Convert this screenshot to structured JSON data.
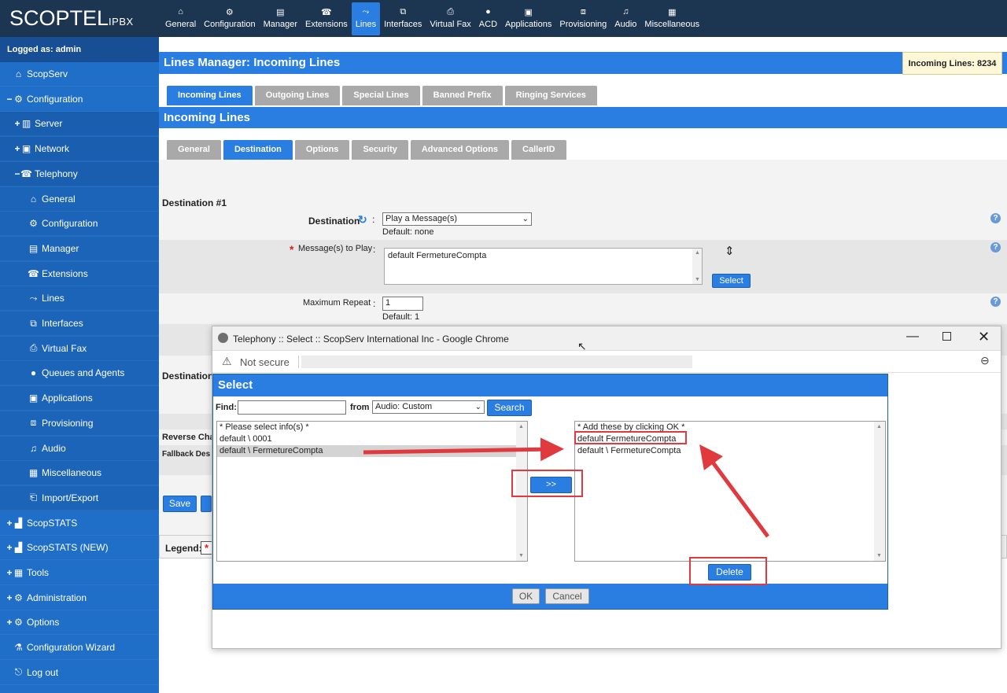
{
  "app": {
    "logo_main": "SCOPTEL",
    "logo_sub": "IPBX"
  },
  "topnav": [
    {
      "label": "General",
      "icon": "home-icon"
    },
    {
      "label": "Configuration",
      "icon": "gear-icon"
    },
    {
      "label": "Manager",
      "icon": "manager-icon"
    },
    {
      "label": "Extensions",
      "icon": "phone-icon"
    },
    {
      "label": "Lines",
      "icon": "lines-icon",
      "active": true
    },
    {
      "label": "Interfaces",
      "icon": "interfaces-icon"
    },
    {
      "label": "Virtual Fax",
      "icon": "fax-icon"
    },
    {
      "label": "ACD",
      "icon": "person-icon"
    },
    {
      "label": "Applications",
      "icon": "applications-icon"
    },
    {
      "label": "Provisioning",
      "icon": "provisioning-icon"
    },
    {
      "label": "Audio",
      "icon": "music-icon"
    },
    {
      "label": "Miscellaneous",
      "icon": "grid-icon"
    }
  ],
  "sidebar": {
    "logged_as": "Logged as: admin",
    "items": [
      {
        "label": "ScopServ",
        "exp": "",
        "level": 0
      },
      {
        "label": "Configuration",
        "exp": "−",
        "level": 0
      },
      {
        "label": "Server",
        "exp": "+",
        "level": 1
      },
      {
        "label": "Network",
        "exp": "+",
        "level": 1
      },
      {
        "label": "Telephony",
        "exp": "−",
        "level": 1
      },
      {
        "label": "General",
        "exp": "",
        "level": 2
      },
      {
        "label": "Configuration",
        "exp": "",
        "level": 2
      },
      {
        "label": "Manager",
        "exp": "",
        "level": 2
      },
      {
        "label": "Extensions",
        "exp": "",
        "level": 2
      },
      {
        "label": "Lines",
        "exp": "",
        "level": 2
      },
      {
        "label": "Interfaces",
        "exp": "",
        "level": 2
      },
      {
        "label": "Virtual Fax",
        "exp": "",
        "level": 2
      },
      {
        "label": "Queues and Agents",
        "exp": "",
        "level": 2
      },
      {
        "label": "Applications",
        "exp": "",
        "level": 2
      },
      {
        "label": "Provisioning",
        "exp": "",
        "level": 2
      },
      {
        "label": "Audio",
        "exp": "",
        "level": 2
      },
      {
        "label": "Miscellaneous",
        "exp": "",
        "level": 2
      },
      {
        "label": "Import/Export",
        "exp": "",
        "level": 2
      },
      {
        "label": "ScopSTATS",
        "exp": "+",
        "level": 0
      },
      {
        "label": "ScopSTATS (NEW)",
        "exp": "+",
        "level": 0
      },
      {
        "label": "Tools",
        "exp": "+",
        "level": 0
      },
      {
        "label": "Administration",
        "exp": "+",
        "level": 0
      },
      {
        "label": "Options",
        "exp": "+",
        "level": 0
      },
      {
        "label": "Configuration Wizard",
        "exp": "",
        "level": 0
      },
      {
        "label": "Log out",
        "exp": "",
        "level": 0
      }
    ]
  },
  "main": {
    "title": "Lines Manager:  Incoming Lines",
    "count_badge": "Incoming Lines: 8234",
    "tabs": [
      "Incoming Lines",
      "Outgoing Lines",
      "Special Lines",
      "Banned Prefix",
      "Ringing Services"
    ],
    "section_title": "Incoming Lines",
    "subtabs": [
      "General",
      "Destination",
      "Options",
      "Security",
      "Advanced Options",
      "CallerID"
    ],
    "destination_heading": "Destination #1",
    "destination_label": "Destination",
    "destination_value": "Play a Message(s)",
    "destination_default": "Default: none",
    "messages_label": "Message(s) to Play",
    "messages_value": "default FermetureCompta",
    "select_button": "Select",
    "max_repeat_label": "Maximum Repeat",
    "max_repeat_value": "1",
    "max_repeat_default": "Default: 1",
    "destination2_partial": "Destination",
    "reverse_partial": "Reverse Cha",
    "fallback_partial": "Fallback Des",
    "save_button": "Save",
    "legend_label": "Legend:"
  },
  "popup": {
    "window_title": "Telephony :: Select :: ScopServ International Inc - Google Chrome",
    "not_secure": "Not secure",
    "heading": "Select",
    "find_label": "Find:",
    "find_value": "",
    "from_label": "from",
    "from_value": "Audio: Custom",
    "search_button": "Search",
    "left_list": [
      "* Please select info(s) *",
      "default \\ 0001",
      "default \\ FermetureCompta"
    ],
    "right_list": [
      "* Add these by clicking OK *",
      "default FermetureCompta",
      "default \\ FermetureCompta"
    ],
    "move_button": ">>",
    "delete_button": "Delete",
    "ok_button": "OK",
    "cancel_button": "Cancel"
  },
  "colors": {
    "accent": "#2a7de1",
    "topbar": "#1c3550",
    "sidebar": "#1f6fc8",
    "highlight": "#e0393e"
  }
}
